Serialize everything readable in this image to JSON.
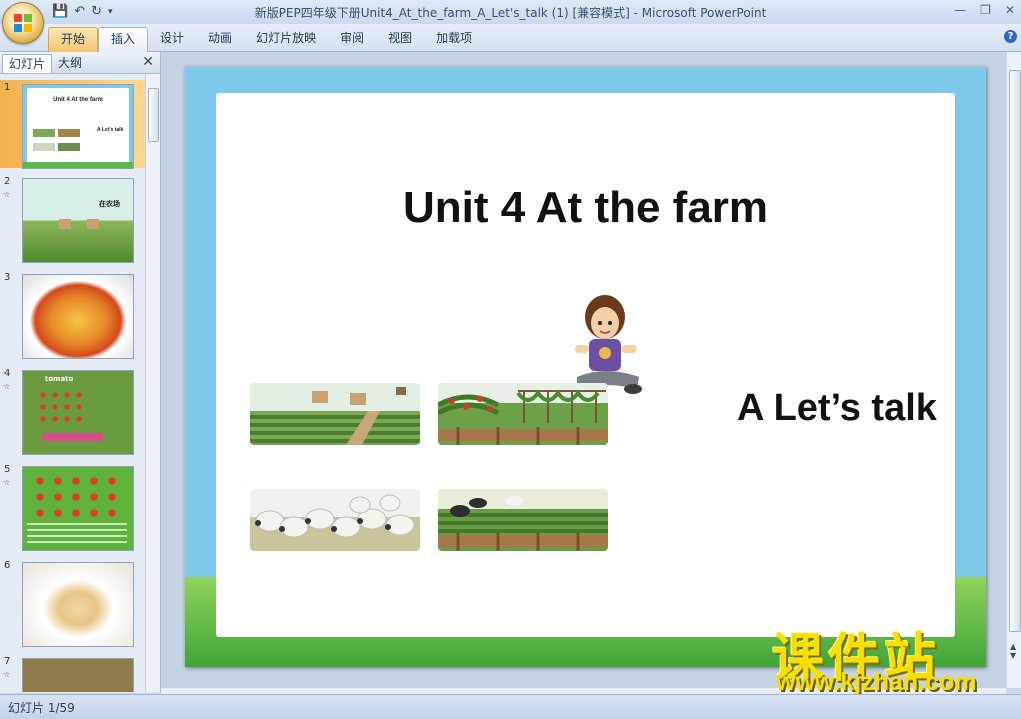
{
  "window": {
    "title": "新版PEP四年级下册Unit4_At_the_farm_A_Let's_talk (1) [兼容模式] - Microsoft PowerPoint"
  },
  "ribbon": {
    "tabs": [
      "开始",
      "插入",
      "设计",
      "动画",
      "幻灯片放映",
      "审阅",
      "视图",
      "加载项"
    ],
    "active_tab": "开始",
    "selected_tab": "插入"
  },
  "panel": {
    "tab_slides": "幻灯片",
    "tab_outline": "大纲",
    "thumbnails": [
      {
        "number": "1",
        "title": "Unit 4 At the farm",
        "subtitle": "A Let's talk"
      },
      {
        "number": "2",
        "text": "在农场"
      },
      {
        "number": "3"
      },
      {
        "number": "4",
        "text": "tomato"
      },
      {
        "number": "5"
      },
      {
        "number": "6"
      },
      {
        "number": "7"
      }
    ]
  },
  "slide": {
    "title": "Unit 4 At the farm",
    "subtitle": "A Let’s talk"
  },
  "status": {
    "slide_counter": "幻灯片 1/59"
  },
  "watermark": {
    "text": "课件站",
    "url": "www.kjzhan.com"
  }
}
